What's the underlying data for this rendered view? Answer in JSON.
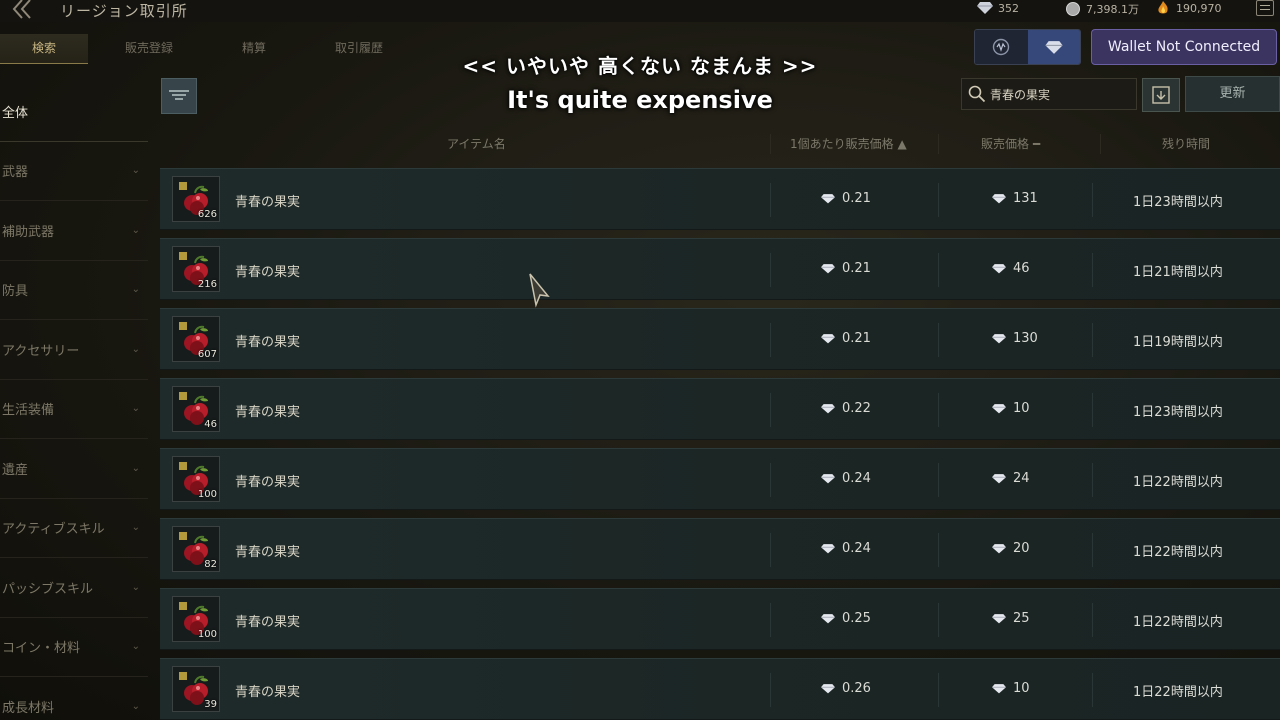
{
  "header": {
    "title": "リージョン取引所",
    "currency": {
      "diamond": "352",
      "silver": "7,398.1万",
      "gold": "190,970"
    }
  },
  "tabs": [
    "検索",
    "販売登録",
    "精算",
    "取引履歴"
  ],
  "subtitle": {
    "jp": "<< いやいや 高くない なまんま >>",
    "en": "It's quite expensive"
  },
  "wallet": {
    "label": "Wallet Not Connected"
  },
  "search": {
    "value": "青春の果実"
  },
  "refresh_label": "更新",
  "sidebar": {
    "items": [
      {
        "label": "全体",
        "active": true
      },
      {
        "label": "武器"
      },
      {
        "label": "補助武器"
      },
      {
        "label": "防具"
      },
      {
        "label": "アクセサリー"
      },
      {
        "label": "生活装備"
      },
      {
        "label": "遺産"
      },
      {
        "label": "アクティブスキル"
      },
      {
        "label": "パッシブスキル"
      },
      {
        "label": "コイン・材料"
      },
      {
        "label": "成長材料"
      }
    ]
  },
  "table": {
    "headers": {
      "name": "アイテム名",
      "unit_price": "1個あたり販売価格 ▲",
      "price": "販売価格 ━",
      "time": "残り時間"
    },
    "rows": [
      {
        "name": "青春の果実",
        "count": "626",
        "unit": "0.21",
        "price": "131",
        "time": "1日23時間以内"
      },
      {
        "name": "青春の果実",
        "count": "216",
        "unit": "0.21",
        "price": "46",
        "time": "1日21時間以内"
      },
      {
        "name": "青春の果実",
        "count": "607",
        "unit": "0.21",
        "price": "130",
        "time": "1日19時間以内"
      },
      {
        "name": "青春の果実",
        "count": "46",
        "unit": "0.22",
        "price": "10",
        "time": "1日23時間以内"
      },
      {
        "name": "青春の果実",
        "count": "100",
        "unit": "0.24",
        "price": "24",
        "time": "1日22時間以内"
      },
      {
        "name": "青春の果実",
        "count": "82",
        "unit": "0.24",
        "price": "20",
        "time": "1日22時間以内"
      },
      {
        "name": "青春の果実",
        "count": "100",
        "unit": "0.25",
        "price": "25",
        "time": "1日22時間以内"
      },
      {
        "name": "青春の果実",
        "count": "39",
        "unit": "0.26",
        "price": "10",
        "time": "1日22時間以内"
      }
    ]
  }
}
